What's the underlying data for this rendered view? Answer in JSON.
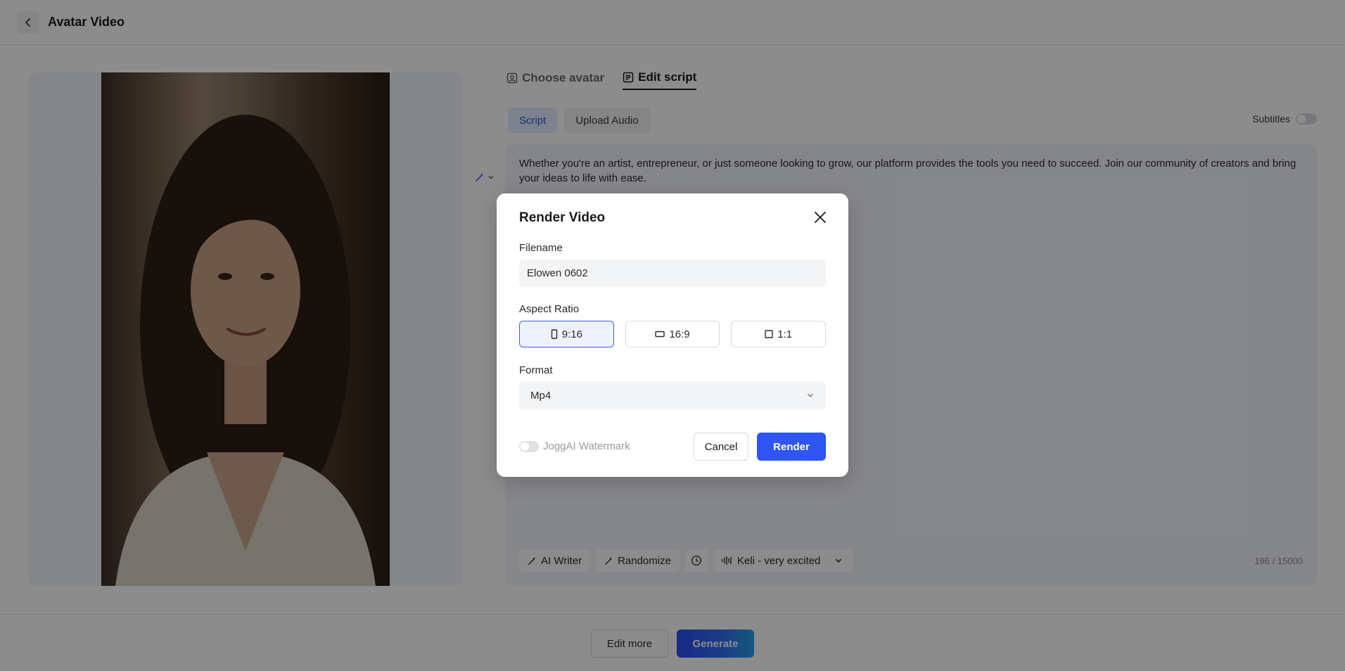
{
  "header": {
    "title": "Avatar Video",
    "back_icon": "chevron-left-icon"
  },
  "tabs": [
    {
      "label": "Choose avatar",
      "icon": "avatar-icon",
      "active": false
    },
    {
      "label": "Edit script",
      "icon": "script-icon",
      "active": true
    }
  ],
  "subtabs": [
    {
      "label": "Script",
      "active": true
    },
    {
      "label": "Upload Audio",
      "active": false
    }
  ],
  "subtitles": {
    "label": "Subtitles",
    "enabled": false
  },
  "script": {
    "text": "Whether you're an artist, entrepreneur, or just someone looking to grow, our platform provides the tools you need to succeed. Join our community of creators and bring your ideas to life with ease.",
    "tools": {
      "ai_writer": "AI Writer",
      "randomize": "Randomize",
      "voice": "Keli - very excited"
    },
    "char_count": "196 / 15000"
  },
  "bottom": {
    "edit_more": "Edit more",
    "generate": "Generate"
  },
  "modal": {
    "title": "Render Video",
    "filename_label": "Filename",
    "filename_value": "Elowen 0602",
    "aspect_label": "Aspect Ratio",
    "ratios": [
      {
        "label": "9:16",
        "icon": "portrait-icon",
        "selected": true
      },
      {
        "label": "16:9",
        "icon": "landscape-icon",
        "selected": false
      },
      {
        "label": "1:1",
        "icon": "square-icon",
        "selected": false
      }
    ],
    "format_label": "Format",
    "format_value": "Mp4",
    "watermark_label": "JoggAI Watermark",
    "watermark_enabled": false,
    "cancel": "Cancel",
    "render": "Render"
  },
  "colors": {
    "accent": "#2f55f5",
    "overlay": "rgba(0,0,0,0.45)"
  }
}
